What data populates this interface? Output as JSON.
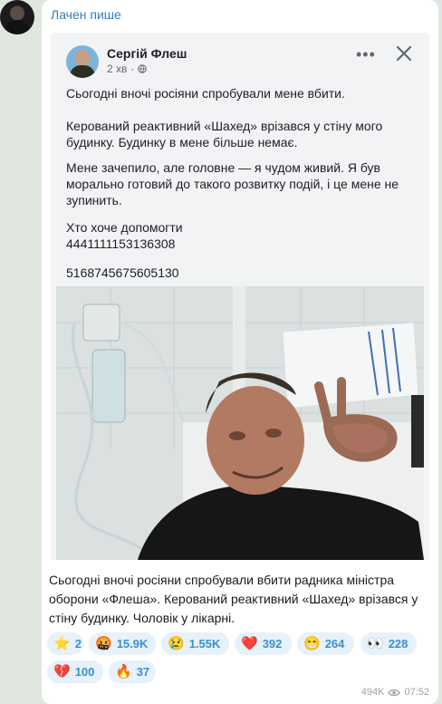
{
  "channel": {
    "name": "Лачен пише"
  },
  "post": {
    "author": "Сергій Флеш",
    "time": "2 хв",
    "paragraphs": [
      "Сьогодні вночі росіяни спробували мене вбити.",
      "Керований реактивний «Шахед» врізався у стіну мого будинку. Будинку в мене більше немає.",
      "Мене зачепило, але головне — я чудом живий.  Я був морально готовий до такого розвитку подій, і це мене не зупинить.",
      "Хто хоче допомогти",
      "4441111153136308",
      "5168745675605130"
    ]
  },
  "caption": "Сьогодні вночі росіяни спробували вбити радника міністра оборони «Флеша». Керований реактивний «Шахед» врізався у стіну будинку. Чоловік у лікарні.",
  "reactions": [
    {
      "emoji": "⭐",
      "count": "2"
    },
    {
      "emoji": "🤬",
      "count": "15.9K"
    },
    {
      "emoji": "😢",
      "count": "1.55K"
    },
    {
      "emoji": "❤️",
      "count": "392"
    },
    {
      "emoji": "😁",
      "count": "264"
    },
    {
      "emoji": "👀",
      "count": "228"
    },
    {
      "emoji": "💔",
      "count": "100"
    },
    {
      "emoji": "🔥",
      "count": "37"
    }
  ],
  "footer": {
    "views": "494K",
    "time": "07:52"
  },
  "icons": [
    "avatar",
    "globe-icon",
    "more-dots-icon",
    "close-icon",
    "eye-icon"
  ]
}
